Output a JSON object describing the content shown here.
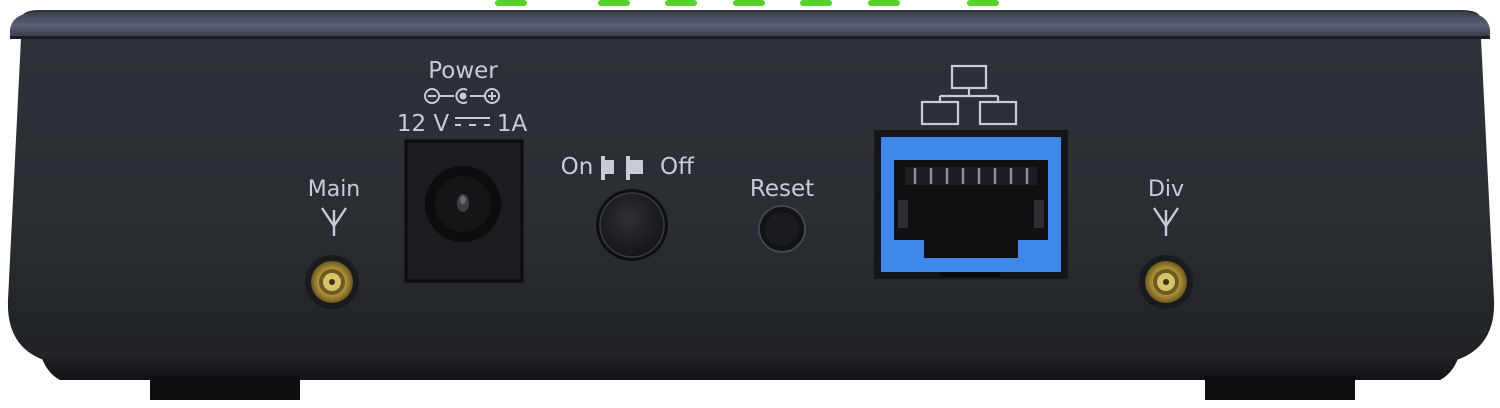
{
  "labels": {
    "power": "Power",
    "voltage": "12 V",
    "current": "1A",
    "on": "On",
    "off": "Off",
    "reset": "Reset",
    "main": "Main",
    "div": "Div"
  },
  "icons": {
    "polarity": "dc-polarity-symbol-icon",
    "dc": "dc-current-symbol-icon",
    "switch": "power-switch-symbol-icon",
    "network": "network-topology-icon",
    "antenna": "antenna-icon"
  },
  "colors": {
    "body": "#2a2d33",
    "top_band": "#4c5164",
    "label_text": "#c9ccd2",
    "led_green": "#57d12c",
    "ethernet_blue": "#3f87e8",
    "sma_gold": "#bda24a"
  }
}
